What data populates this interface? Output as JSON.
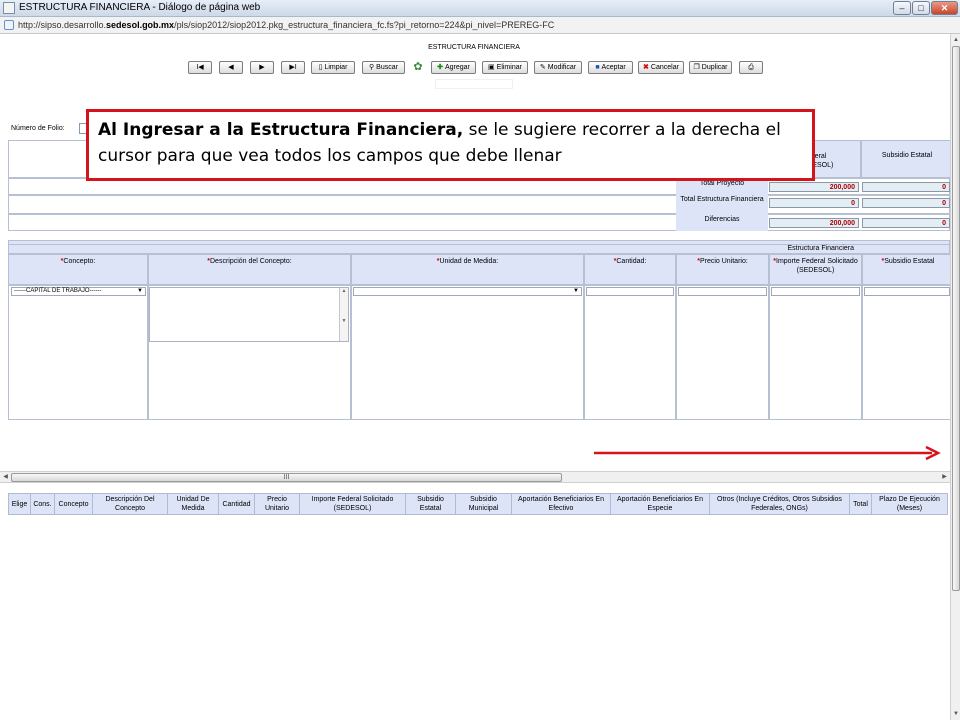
{
  "window": {
    "title": "ESTRUCTURA FINANCIERA - Diálogo de página web",
    "url_prefix": "http://sipso.desarrollo.",
    "url_host": "sedesol.gob.mx",
    "url_suffix": "/pls/siop2012/siop2012.pkg_estructura_financiera_fc.fs?pi_retorno=224&pi_nivel=PREREG-FC"
  },
  "page": {
    "heading": "ESTRUCTURA FINANCIERA"
  },
  "toolbar": {
    "first": "I◀",
    "prev": "◀",
    "next": "▶",
    "last": "▶I",
    "limpiar": "Limpiar",
    "buscar": "Buscar",
    "agregar": "Agregar",
    "eliminar": "Eliminar",
    "modificar": "Modificar",
    "aceptar": "Aceptar",
    "cancelar": "Cancelar",
    "duplicar": "Duplicar"
  },
  "folio": {
    "label": "Número de Folio:"
  },
  "callout": {
    "bold_text": "Al Ingresar a la Estructura Financiera,",
    "text": " se le sugiere recorrer a la derecha el cursor para que vea todos los campos que debe llenar"
  },
  "summary": {
    "col_federal_partial": "Federal",
    "col_federal_partial2": "(SEDESOL)",
    "col_estatal": "Subsidio Estatal",
    "rows": [
      {
        "label": "Total Proyecto",
        "federal": "200,000",
        "estatal": "0"
      },
      {
        "label": "Total Estructura Financiera",
        "federal": "0",
        "estatal": "0"
      },
      {
        "label": "Diferencias",
        "federal": "200,000",
        "estatal": "0"
      }
    ]
  },
  "form": {
    "section_title": "Estructura Financiera",
    "columns": [
      {
        "req": "*",
        "label": "Concepto:"
      },
      {
        "req": "*",
        "label": "Descripción del Concepto:"
      },
      {
        "req": "*",
        "label": "Unidad de Medida:"
      },
      {
        "req": "*",
        "label": "Cantidad:"
      },
      {
        "req": "*",
        "label": "Precio Unitario:"
      },
      {
        "req": "*",
        "label": "Importe Federal Solicitado (SEDESOL)"
      },
      {
        "req": "*",
        "label": "Subsidio Estatal"
      }
    ],
    "concepto_value": "------CAPITAL DE TRABAJO------"
  },
  "scrollbar": {
    "grip": "III"
  },
  "list_table": {
    "headers": [
      "Elige",
      "Cons.",
      "Concepto",
      "Descripción Del Concepto",
      "Unidad De Medida",
      "Cantidad",
      "Precio Unitario",
      "Importe Federal Solicitado (SEDESOL)",
      "Subsidio Estatal",
      "Subsidio Municipal",
      "Aportación Beneficiarios En Efectivo",
      "Aportación Beneficiarios En Especie",
      "Otros (Incluye Créditos, Otros Subsidios Federales, ONGs)",
      "Total",
      "Plazo De Ejecución (Meses)"
    ]
  },
  "colors": {
    "accent_red": "#d6131b",
    "header_blue": "#dde4f8",
    "value_red": "#b00000"
  }
}
